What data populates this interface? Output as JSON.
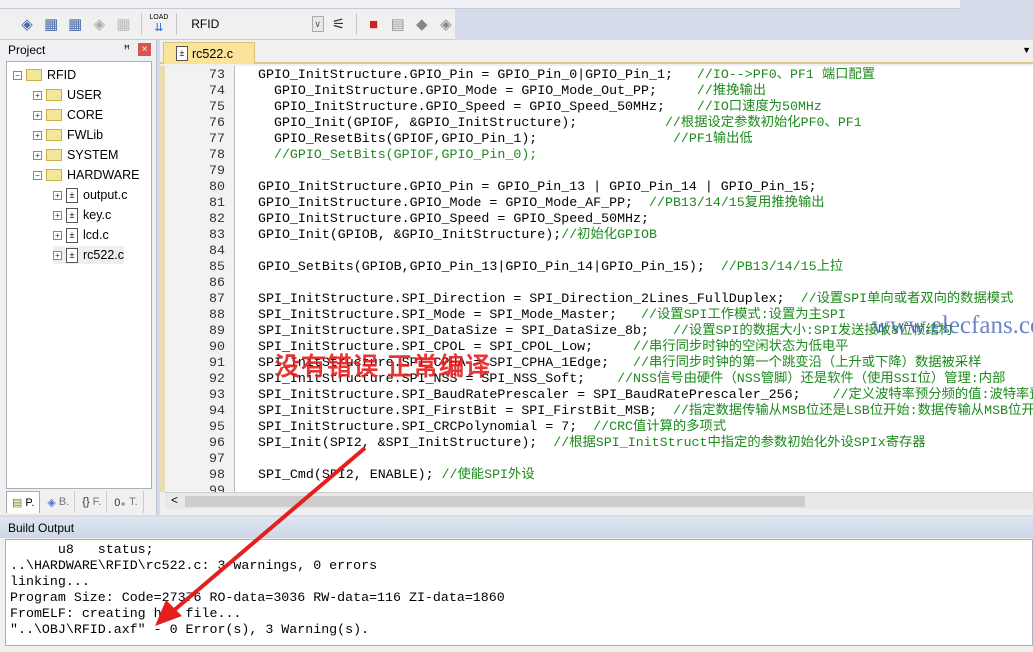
{
  "toolbar": {
    "target": "RFID",
    "icons": [
      "translate-icon",
      "build-icon",
      "rebuild-icon",
      "batch-build-icon",
      "stop-build-icon",
      "load-icon",
      "target-options-icon",
      "manage-components-icon",
      "file-extensions-icon",
      "pack-installer-icon",
      "env-icon"
    ],
    "load_label": "LOAD"
  },
  "project": {
    "title": "Project",
    "root": "RFID",
    "groups": [
      "USER",
      "CORE",
      "FWLib",
      "SYSTEM",
      "HARDWARE"
    ],
    "files": [
      "output.c",
      "key.c",
      "lcd.c",
      "rc522.c"
    ],
    "tabs": [
      "P.",
      "B.",
      "F.",
      "T."
    ]
  },
  "editor": {
    "tab": "rc522.c",
    "lines": [
      {
        "n": "73",
        "code": "GPIO_InitStructure.GPIO_Pin = GPIO_Pin_0|GPIO_Pin_1;   ",
        "comment": "//IO-->PF0、PF1 端口配置"
      },
      {
        "n": "74",
        "code": "  GPIO_InitStructure.GPIO_Mode = GPIO_Mode_Out_PP;     ",
        "comment": "//推挽输出"
      },
      {
        "n": "75",
        "code": "  GPIO_InitStructure.GPIO_Speed = GPIO_Speed_50MHz;    ",
        "comment": "//IO口速度为50MHz"
      },
      {
        "n": "76",
        "code": "  GPIO_Init(GPIOF, &GPIO_InitStructure);           ",
        "comment": "//根据设定参数初始化PF0、PF1"
      },
      {
        "n": "77",
        "code": "  GPIO_ResetBits(GPIOF,GPIO_Pin_1);                 ",
        "comment": "//PF1输出低"
      },
      {
        "n": "78",
        "code": "  ",
        "comment": "//GPIO_SetBits(GPIOF,GPIO_Pin_0);"
      },
      {
        "n": "79",
        "code": "",
        "comment": ""
      },
      {
        "n": "80",
        "code": "GPIO_InitStructure.GPIO_Pin = GPIO_Pin_13 | GPIO_Pin_14 | GPIO_Pin_15;",
        "comment": ""
      },
      {
        "n": "81",
        "code": "GPIO_InitStructure.GPIO_Mode = GPIO_Mode_AF_PP;  ",
        "comment": "//PB13/14/15复用推挽输出"
      },
      {
        "n": "82",
        "code": "GPIO_InitStructure.GPIO_Speed = GPIO_Speed_50MHz;",
        "comment": ""
      },
      {
        "n": "83",
        "code": "GPIO_Init(GPIOB, &GPIO_InitStructure);",
        "comment": "//初始化GPIOB"
      },
      {
        "n": "84",
        "code": "",
        "comment": ""
      },
      {
        "n": "85",
        "code": "GPIO_SetBits(GPIOB,GPIO_Pin_13|GPIO_Pin_14|GPIO_Pin_15);  ",
        "comment": "//PB13/14/15上拉"
      },
      {
        "n": "86",
        "code": "",
        "comment": ""
      },
      {
        "n": "87",
        "code": "SPI_InitStructure.SPI_Direction = SPI_Direction_2Lines_FullDuplex;  ",
        "comment": "//设置SPI单向或者双向的数据模式"
      },
      {
        "n": "88",
        "code": "SPI_InitStructure.SPI_Mode = SPI_Mode_Master;   ",
        "comment": "//设置SPI工作模式:设置为主SPI"
      },
      {
        "n": "89",
        "code": "SPI_InitStructure.SPI_DataSize = SPI_DataSize_8b;   ",
        "comment": "//设置SPI的数据大小:SPI发送接收8位帧结构"
      },
      {
        "n": "90",
        "code": "SPI_InitStructure.SPI_CPOL = SPI_CPOL_Low;     ",
        "comment": "//串行同步时钟的空闲状态为低电平"
      },
      {
        "n": "91",
        "code": "SPI_InitStructure.SPI_CPHA = SPI_CPHA_1Edge;   ",
        "comment": "//串行同步时钟的第一个跳变沿（上升或下降）数据被采样"
      },
      {
        "n": "92",
        "code": "SPI_InitStructure.SPI_NSS = SPI_NSS_Soft;    ",
        "comment": "//NSS信号由硬件（NSS管脚）还是软件（使用SSI位）管理:内部"
      },
      {
        "n": "93",
        "code": "SPI_InitStructure.SPI_BaudRatePrescaler = SPI_BaudRatePrescaler_256;    ",
        "comment": "//定义波特率预分频的值:波特率预分频值为256"
      },
      {
        "n": "94",
        "code": "SPI_InitStructure.SPI_FirstBit = SPI_FirstBit_MSB;  ",
        "comment": "//指定数据传输从MSB位还是LSB位开始:数据传输从MSB位开始"
      },
      {
        "n": "95",
        "code": "SPI_InitStructure.SPI_CRCPolynomial = 7;  ",
        "comment": "//CRC值计算的多项式"
      },
      {
        "n": "96",
        "code": "SPI_Init(SPI2, &SPI_InitStructure);  ",
        "comment": "//根据SPI_InitStruct中指定的参数初始化外设SPIx寄存器"
      },
      {
        "n": "97",
        "code": "",
        "comment": ""
      },
      {
        "n": "98",
        "code": "SPI_Cmd(SPI2, ENABLE); ",
        "comment": "//使能SPI外设"
      },
      {
        "n": "99",
        "code": "",
        "comment": ""
      }
    ]
  },
  "build": {
    "title": "Build Output",
    "lines": [
      "      u8   status;",
      "..\\HARDWARE\\RFID\\rc522.c: 3 warnings, 0 errors",
      "linking...",
      "Program Size: Code=27376 RO-data=3036 RW-data=116 ZI-data=1860",
      "FromELF: creating hex file...",
      "\"..\\OBJ\\RFID.axf\" - 0 Error(s), 3 Warning(s)."
    ]
  },
  "annotation": {
    "text": "没有错误 正常编译",
    "color": "#e4201f"
  },
  "watermark": "www.elecfans.com",
  "colors": {
    "comment": "#1d8a1d",
    "tab_active": "#fbe39a"
  }
}
